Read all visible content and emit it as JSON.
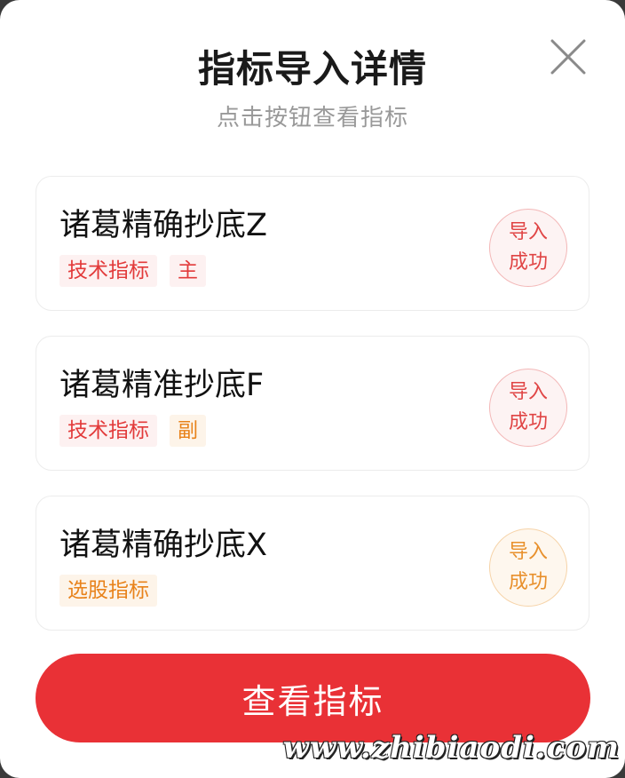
{
  "dialog": {
    "title": "指标导入详情",
    "subtitle": "点击按钮查看指标",
    "close_icon": "close-icon"
  },
  "indicators": [
    {
      "name": "诸葛精确抄底Z",
      "tags": [
        {
          "label": "技术指标",
          "color": "#e23a3a"
        },
        {
          "label": "主",
          "color": "#e23a3a"
        }
      ],
      "status_line1": "导入",
      "status_line2": "成功",
      "status_color": "#e04545"
    },
    {
      "name": "诸葛精准抄底F",
      "tags": [
        {
          "label": "技术指标",
          "color": "#e23a3a"
        },
        {
          "label": "副",
          "color": "#e8821a"
        }
      ],
      "status_line1": "导入",
      "status_line2": "成功",
      "status_color": "#e04545"
    },
    {
      "name": "诸葛精确抄底X",
      "tags": [
        {
          "label": "选股指标",
          "color": "#e8821a"
        }
      ],
      "status_line1": "导入",
      "status_line2": "成功",
      "status_color": "#e8902c"
    }
  ],
  "footer": {
    "view_button_label": "查看指标",
    "button_color": "#e93136"
  },
  "watermark": "www.zhibiaodi.com"
}
